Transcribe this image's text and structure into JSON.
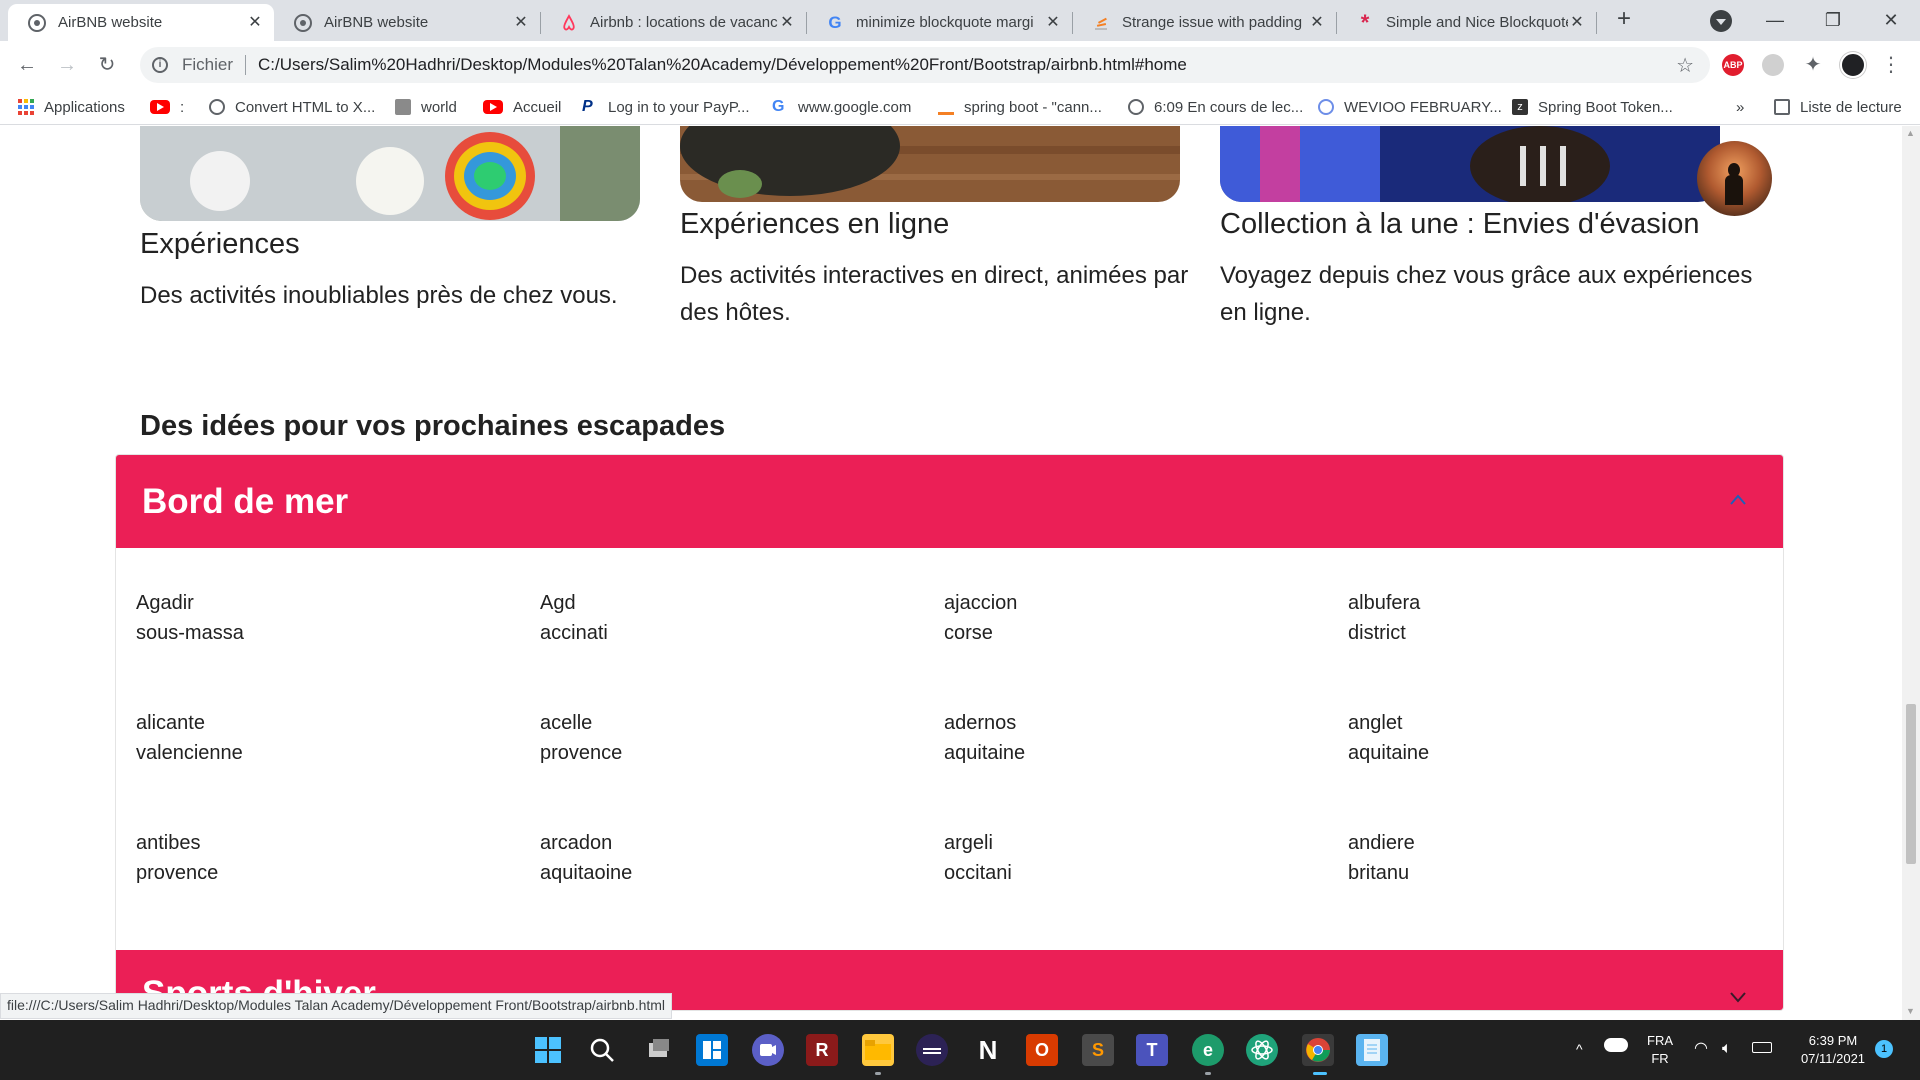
{
  "browser": {
    "tabs": [
      {
        "title": "AirBNB website",
        "icon": "globe-icon",
        "active": true
      },
      {
        "title": "AirBNB website",
        "icon": "globe-icon",
        "active": false
      },
      {
        "title": "Airbnb : locations de vacanc",
        "icon": "airbnb-icon",
        "active": false
      },
      {
        "title": "minimize blockquote margi",
        "icon": "google-icon",
        "active": false
      },
      {
        "title": "Strange issue with padding",
        "icon": "stackoverflow-icon",
        "active": false
      },
      {
        "title": "Simple and Nice Blockquote",
        "icon": "asterisk-icon",
        "active": false
      }
    ],
    "address": {
      "scheme": "Fichier",
      "url": "C:/Users/Salim%20Hadhri/Desktop/Modules%20Talan%20Academy/Développement%20Front/Bootstrap/airbnb.html#home"
    },
    "bookmarks": [
      {
        "label": "Applications",
        "icon": "apps-grid-icon"
      },
      {
        "label": ":",
        "icon": "youtube-icon"
      },
      {
        "label": "Convert HTML to X...",
        "icon": "globe-icon"
      },
      {
        "label": "world",
        "icon": "image-icon"
      },
      {
        "label": "Accueil",
        "icon": "youtube-icon"
      },
      {
        "label": "Log in to your PayP...",
        "icon": "paypal-icon"
      },
      {
        "label": "www.google.com",
        "icon": "google-icon"
      },
      {
        "label": "spring boot - \"cann...",
        "icon": "stackoverflow-icon"
      },
      {
        "label": "6:09 En cours de lec...",
        "icon": "globe-icon"
      },
      {
        "label": "WEVIOO FEBRUARY...",
        "icon": "globe-icon"
      },
      {
        "label": "Spring Boot Token...",
        "icon": "z-icon"
      }
    ],
    "reading_list": "Liste de lecture",
    "more_bookmarks": "»"
  },
  "page": {
    "cards": [
      {
        "title": "Expériences",
        "desc": "Des activités inoubliables près de chez vous."
      },
      {
        "title": "Expériences en ligne",
        "desc": "Des activités interactives en direct, animées par des hôtes."
      },
      {
        "title": "Collection à la une : Envies d'évasion",
        "desc": "Voyagez depuis chez vous grâce aux expériences en ligne."
      }
    ],
    "section_heading": "Des idées pour vos prochaines escapades",
    "accordion": [
      {
        "title": "Bord de mer",
        "expanded": true,
        "destinations": [
          {
            "city": "Agadir",
            "region": "sous-massa"
          },
          {
            "city": "Agd",
            "region": "accinati"
          },
          {
            "city": "ajaccion",
            "region": "corse"
          },
          {
            "city": "albufera",
            "region": "district"
          },
          {
            "city": "alicante",
            "region": "valencienne"
          },
          {
            "city": "acelle",
            "region": "provence"
          },
          {
            "city": "adernos",
            "region": "aquitaine"
          },
          {
            "city": "anglet",
            "region": "aquitaine"
          },
          {
            "city": "antibes",
            "region": "provence"
          },
          {
            "city": "arcadon",
            "region": "aquitaoine"
          },
          {
            "city": "argeli",
            "region": "occitani"
          },
          {
            "city": "andiere",
            "region": "britanu"
          }
        ]
      },
      {
        "title": "Sports d'hiver",
        "expanded": false
      }
    ],
    "accent_color": "#eb1f56"
  },
  "status_bar": {
    "link_url": "file:///C:/Users/Salim Hadhri/Desktop/Modules Talan Academy/Développement Front/Bootstrap/airbnb.html"
  },
  "taskbar": {
    "language": "FRA",
    "layout": "FR",
    "time": "6:39 PM",
    "date": "07/11/2021",
    "notification_count": "1"
  }
}
